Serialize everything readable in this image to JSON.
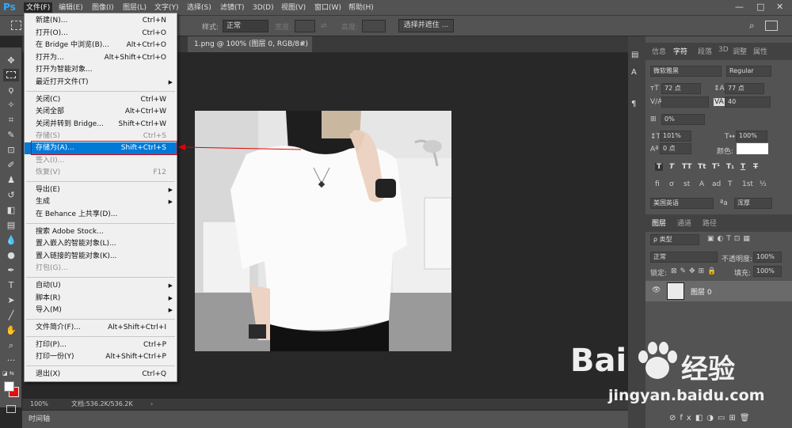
{
  "app": {
    "logo": "Ps"
  },
  "menubar": {
    "items": [
      "文件(F)",
      "编辑(E)",
      "图像(I)",
      "图层(L)",
      "文字(Y)",
      "选择(S)",
      "滤镜(T)",
      "3D(D)",
      "视图(V)",
      "窗口(W)",
      "帮助(H)"
    ]
  },
  "window_controls": {
    "minimize": "—",
    "restore": "□",
    "close": "✕"
  },
  "options": {
    "style_label": "样式:",
    "style_value": "正常",
    "width_label": "宽度:",
    "height_label": "高度:",
    "select_mask_button": "选择并遮住 ..."
  },
  "document": {
    "tab_title": "1.png @ 100% (图层 0, RGB/8#)",
    "tab_close": "×"
  },
  "status": {
    "zoom": "100%",
    "doc_size": "文档:536.2K/536.2K"
  },
  "timeline": {
    "label": "时间轴"
  },
  "file_menu": {
    "items": [
      {
        "label": "新建(N)...",
        "shortcut": "Ctrl+N"
      },
      {
        "label": "打开(O)...",
        "shortcut": "Ctrl+O"
      },
      {
        "label": "在 Bridge 中浏览(B)...",
        "shortcut": "Alt+Ctrl+O"
      },
      {
        "label": "打开为...",
        "shortcut": "Alt+Shift+Ctrl+O"
      },
      {
        "label": "打开为智能对象...",
        "shortcut": ""
      },
      {
        "label": "最近打开文件(T)",
        "shortcut": ""
      },
      {
        "label": "关闭(C)",
        "shortcut": "Ctrl+W"
      },
      {
        "label": "关闭全部",
        "shortcut": "Alt+Ctrl+W"
      },
      {
        "label": "关闭并转到 Bridge...",
        "shortcut": "Shift+Ctrl+W"
      },
      {
        "label": "存储(S)",
        "shortcut": "Ctrl+S"
      },
      {
        "label": "存储为(A)...",
        "shortcut": "Shift+Ctrl+S"
      },
      {
        "label": "签入(I)...",
        "shortcut": ""
      },
      {
        "label": "恢复(V)",
        "shortcut": "F12"
      },
      {
        "label": "导出(E)",
        "shortcut": ""
      },
      {
        "label": "生成",
        "shortcut": ""
      },
      {
        "label": "在 Behance 上共享(D)...",
        "shortcut": ""
      },
      {
        "label": "搜索 Adobe Stock...",
        "shortcut": ""
      },
      {
        "label": "置入嵌入的智能对象(L)...",
        "shortcut": ""
      },
      {
        "label": "置入链接的智能对象(K)...",
        "shortcut": ""
      },
      {
        "label": "打包(G)...",
        "shortcut": ""
      },
      {
        "label": "自动(U)",
        "shortcut": ""
      },
      {
        "label": "脚本(R)",
        "shortcut": ""
      },
      {
        "label": "导入(M)",
        "shortcut": ""
      },
      {
        "label": "文件简介(F)...",
        "shortcut": "Alt+Shift+Ctrl+I"
      },
      {
        "label": "打印(P)...",
        "shortcut": "Ctrl+P"
      },
      {
        "label": "打印一份(Y)",
        "shortcut": "Alt+Shift+Ctrl+P"
      },
      {
        "label": "退出(X)",
        "shortcut": "Ctrl+Q"
      }
    ],
    "submenu_arrow": "▶"
  },
  "char_panel": {
    "tabs": [
      "信息",
      "字符",
      "段落",
      "3D",
      "调整",
      "属性"
    ],
    "font_family": "微软雅黑",
    "font_style": "Regular",
    "size": "72 点",
    "leading": "77 点",
    "kerning": "",
    "tracking": "40",
    "vscale_pct": "0%",
    "vert_scale": "101%",
    "horiz_scale": "100%",
    "baseline": "0 点",
    "color_label": "颜色:",
    "style_buttons": [
      "T",
      "T",
      "TT",
      "Tt",
      "T¹",
      "T₁",
      "T",
      "T"
    ],
    "ot_buttons": [
      "fi",
      "ơ",
      "st",
      "A",
      "ad",
      "T",
      "1st",
      "½"
    ],
    "language": "美国英语",
    "aa_label": "ªa",
    "aa_value": "浑厚"
  },
  "layers_panel": {
    "tabs": [
      "图层",
      "通道",
      "路径"
    ],
    "kind": "ρ 类型",
    "blend": "正常",
    "opacity_label": "不透明度:",
    "opacity": "100%",
    "lock_label": "锁定:",
    "fill_label": "填充:",
    "fill": "100%",
    "layer_name": "图层 0"
  },
  "watermark": {
    "brand": "Bai",
    "brand2": "经验",
    "url": "jingyan.baidu.com"
  },
  "colors": {
    "highlight": "#0079d7",
    "callout": "#e00000",
    "ps_blue": "#31a8ff"
  }
}
